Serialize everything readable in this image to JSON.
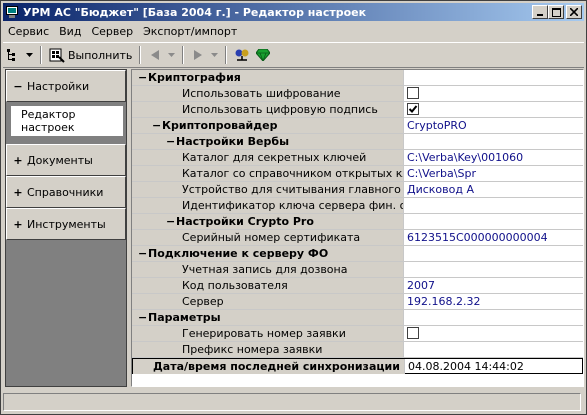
{
  "window": {
    "title": "УРМ АС \"Бюджет\" [База 2004 г.] - Редактор настроек"
  },
  "menu": [
    "Сервис",
    "Вид",
    "Сервер",
    "Экспорт/импорт"
  ],
  "toolbar": {
    "run_label": "Выполнить"
  },
  "navigation": {
    "groups": [
      {
        "sign": "−",
        "label": "Настройки"
      },
      {
        "sign": "+",
        "label": "Документы"
      },
      {
        "sign": "+",
        "label": "Справочники"
      },
      {
        "sign": "+",
        "label": "Инструменты"
      }
    ],
    "active_item": "Редактор настроек"
  },
  "settings": [
    {
      "sign": "−",
      "label": "Криптография",
      "level": 0,
      "header": true,
      "value": ""
    },
    {
      "label": "Использовать шифрование",
      "level": 2,
      "checkbox": true,
      "checked": false
    },
    {
      "label": "Использовать цифровую подпись",
      "level": 2,
      "checkbox": true,
      "checked": true
    },
    {
      "sign": "−",
      "label": "Криптопровайдер",
      "level": 1,
      "header": true,
      "value": "CryptoPRO"
    },
    {
      "sign": "−",
      "label": "Настройки Вербы",
      "level": 2,
      "header": true,
      "value": ""
    },
    {
      "label": "Каталог для секретных ключей",
      "level": 3,
      "value": "C:\\Verba\\Key\\001060"
    },
    {
      "label": "Каталог со справочником открытых ключей",
      "level": 3,
      "value": "C:\\Verba\\Spr"
    },
    {
      "label": "Устройство для считывания главного ключа",
      "level": 3,
      "value": "Дисковод A"
    },
    {
      "label": "Идентификатор ключа сервера фин. органа",
      "level": 3,
      "value": ""
    },
    {
      "sign": "−",
      "label": "Настройки Crypto Pro",
      "level": 2,
      "header": true,
      "value": ""
    },
    {
      "label": "Серийный номер сертификата",
      "level": 3,
      "value": "6123515C000000000004"
    },
    {
      "sign": "−",
      "label": "Подключение к серверу ФО",
      "level": 0,
      "header": true,
      "value": ""
    },
    {
      "label": "Учетная запись для дозвона",
      "level": 2,
      "value": ""
    },
    {
      "label": "Код пользователя",
      "level": 2,
      "value": "2007"
    },
    {
      "label": "Сервер",
      "level": 2,
      "value": "192.168.2.32"
    },
    {
      "sign": "−",
      "label": "Параметры",
      "level": 0,
      "header": true,
      "value": ""
    },
    {
      "label": "Генерировать номер заявки",
      "level": 2,
      "checkbox": true,
      "checked": false
    },
    {
      "label": "Префикс номера заявки",
      "level": 2,
      "value": ""
    },
    {
      "label": "Дата/время последней синхронизации",
      "level": 1,
      "header": true,
      "selected": true,
      "value": "04.08.2004 14:44:02"
    }
  ]
}
